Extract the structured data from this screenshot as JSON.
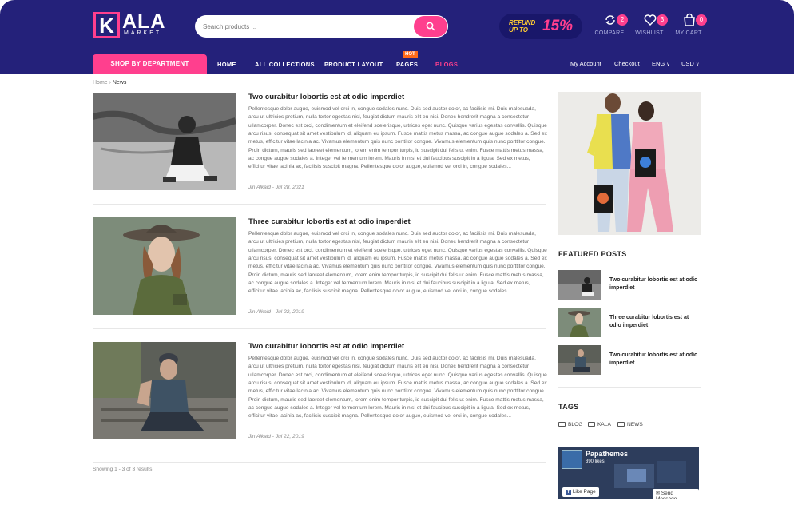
{
  "brand": {
    "logo_letter": "K",
    "name": "ALA",
    "tagline": "MARKET",
    "accent": "#ff3f8e",
    "header_bg": "#24217a"
  },
  "search": {
    "placeholder": "Search products ..."
  },
  "promo": {
    "line": "REFUND UP TO",
    "amount": "15%"
  },
  "header_icons": [
    {
      "icon": "compare-icon",
      "label": "COMPARE",
      "count": "2"
    },
    {
      "icon": "heart-icon",
      "label": "WISHLIST",
      "count": "3"
    },
    {
      "icon": "cart-icon",
      "label": "MY CART",
      "count": "0"
    }
  ],
  "nav": {
    "shop_label": "SHOP BY DEPARTMENT",
    "items": [
      "HOME",
      "ALL COLLECTIONS",
      "PRODUCT LAYOUT",
      "PAGES",
      "BLOGS"
    ],
    "hot_badge": "HOT",
    "account": "My Account",
    "checkout": "Checkout",
    "language": "ENG",
    "currency": "USD"
  },
  "breadcrumb": {
    "home": "Home",
    "current": "News"
  },
  "posts": [
    {
      "title": "Two curabitur lobortis est at odio imperdiet",
      "body": "Pellentesque dolor augue, euismod vel orci in, congue sodales nunc. Duis sed auctor dolor, ac facilisis mi. Duis malesuada, arcu ut ultricies pretium, nulla tortor egestas nisl, feugiat dictum mauris elit eu nisi. Donec hendrerit magna a consectetur ullamcorper. Donec est orci, condimentum et eleifend scelerisque, ultrices eget nunc. Quisque varius egestas convallis. Quisque arcu risus, consequat sit amet vestibulum id, aliquam eu ipsum. Fusce mattis metus massa, ac congue augue sodales a. Sed ex metus, efficitur vitae lacinia ac. Vivamus elementum quis nunc porttitor congue. Vivamus elementum quis nunc porttitor congue. Proin dictum, mauris sed laoreet elementum, lorem enim tempor turpis, id suscipit dui felis ut enim. Fusce mattis metus massa, ac congue augue sodales a. Integer vel fermentum lorem. Mauris in nisl et dui faucibus suscipit in a ligula. Sed ex metus, efficitur vitae lacinia ac, facilisis suscipit magna. Pellentesque dolor augue, euismod vel orci in, congue sodales...",
      "meta": "Jin Alkaid - Jul 28, 2021"
    },
    {
      "title": "Three curabitur lobortis est at odio imperdiet",
      "body": "Pellentesque dolor augue, euismod vel orci in, congue sodales nunc. Duis sed auctor dolor, ac facilisis mi. Duis malesuada, arcu ut ultricies pretium, nulla tortor egestas nisl, feugiat dictum mauris elit eu nisi. Donec hendrerit magna a consectetur ullamcorper. Donec est orci, condimentum et eleifend scelerisque, ultrices eget nunc. Quisque varius egestas convallis. Quisque arcu risus, consequat sit amet vestibulum id, aliquam eu ipsum. Fusce mattis metus massa, ac congue augue sodales a. Sed ex metus, efficitur vitae lacinia ac. Vivamus elementum quis nunc porttitor congue. Vivamus elementum quis nunc porttitor congue. Proin dictum, mauris sed laoreet elementum, lorem enim tempor turpis, id suscipit dui felis ut enim. Fusce mattis metus massa, ac congue augue sodales a. Integer vel fermentum lorem. Mauris in nisl et dui faucibus suscipit in a ligula. Sed ex metus, efficitur vitae lacinia ac, facilisis suscipit magna. Pellentesque dolor augue, euismod vel orci in, congue sodales...",
      "meta": "Jin Alkaid - Jul 22, 2019"
    },
    {
      "title": "Two curabitur lobortis est at odio imperdiet",
      "body": "Pellentesque dolor augue, euismod vel orci in, congue sodales nunc. Duis sed auctor dolor, ac facilisis mi. Duis malesuada, arcu ut ultricies pretium, nulla tortor egestas nisl, feugiat dictum mauris elit eu nisi. Donec hendrerit magna a consectetur ullamcorper. Donec est orci, condimentum et eleifend scelerisque, ultrices eget nunc. Quisque varius egestas convallis. Quisque arcu risus, consequat sit amet vestibulum id, aliquam eu ipsum. Fusce mattis metus massa, ac congue augue sodales a. Sed ex metus, efficitur vitae lacinia ac. Vivamus elementum quis nunc porttitor congue. Vivamus elementum quis nunc porttitor congue. Proin dictum, mauris sed laoreet elementum, lorem enim tempor turpis, id suscipit dui felis ut enim. Fusce mattis metus massa, ac congue augue sodales a. Integer vel fermentum lorem. Mauris in nisl et dui faucibus suscipit in a ligula. Sed ex metus, efficitur vitae lacinia ac, facilisis suscipit magna. Pellentesque dolor augue, euismod vel orci in, congue sodales...",
      "meta": "Jin Alkaid - Jul 22, 2019"
    }
  ],
  "results": "Showing 1 - 3 of 3 results",
  "sidebar": {
    "featured_heading": "FEATURED POSTS",
    "featured": [
      {
        "title": "Two curabitur lobortis est at odio imperdiet"
      },
      {
        "title": "Three curabitur lobortis est at odio imperdiet"
      },
      {
        "title": "Two curabitur lobortis est at odio imperdiet"
      }
    ],
    "tags_heading": "TAGS",
    "tags": [
      "BLOG",
      "KALA",
      "NEWS"
    ],
    "facebook": {
      "page_name": "Papathemes",
      "likes": "390 likes",
      "like_button": "Like Page",
      "send_button": "Send Message"
    }
  }
}
